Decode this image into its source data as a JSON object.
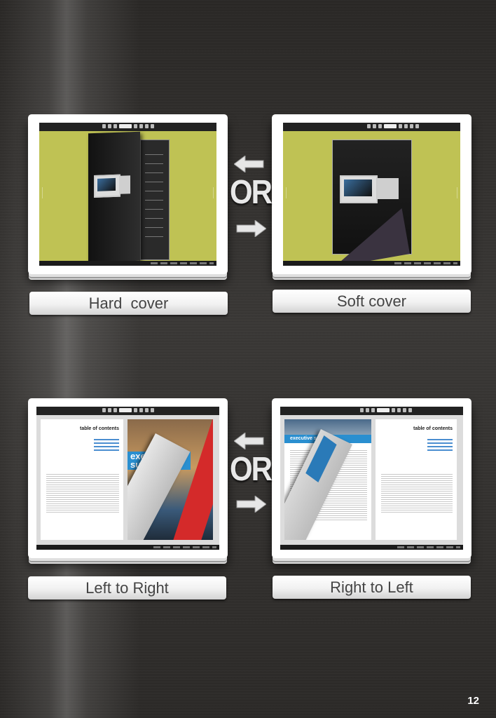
{
  "option_groups": [
    {
      "left_label": "Hard  cover",
      "right_label": "Soft cover",
      "divider_text": "OR"
    },
    {
      "left_label": "Left to Right",
      "right_label": "Right to Left",
      "divider_text": "OR"
    }
  ],
  "books": {
    "toc_title": "table of contents",
    "feature_title": "executive summary"
  },
  "page_number": "12",
  "colors": {
    "screen_green": "#bfc254",
    "accent_red": "#d42a2a",
    "accent_blue": "#2a8fd0"
  },
  "icons": [
    "left-arrow-icon",
    "right-arrow-icon",
    "zoom-icon",
    "first-page-icon",
    "prev-page-icon",
    "next-page-icon",
    "last-page-icon"
  ]
}
